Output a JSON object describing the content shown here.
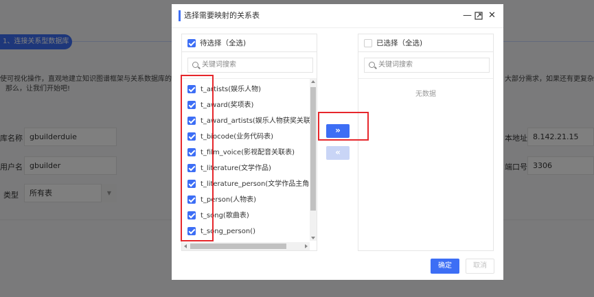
{
  "background": {
    "step_label": "1、连接关系型数据库",
    "intro_text": "使可视化操作，直观地建立知识图谱框架与关系数据库的联系；适",
    "intro_text_right": "大部分需求，如果还有更复杂的要",
    "intro_text2": "那么，让我们开始吧!",
    "fields": {
      "db_name_label": "库名称",
      "db_name_value": "gbuilderduie",
      "user_label": "用户名",
      "user_value": "gbuilder",
      "type_label": "类型",
      "type_value": "所有表",
      "host_label": "本地址",
      "host_value": "8.142.21.15",
      "port_label": "端口号",
      "port_value": "3306"
    }
  },
  "dialog": {
    "title": "选择需要映射的关系表",
    "header_icons": [
      "minimize-icon",
      "maximize-icon",
      "close-icon"
    ],
    "left_panel": {
      "header": "待选择（全选)",
      "header_checked": true,
      "search_placeholder": "关键词搜索",
      "items": [
        "t_artists(娱乐人物)",
        "t_award(奖项表)",
        "t_award_artists(娱乐人物获奖关联表)",
        "t_biocode(业务代码表)",
        "t_film_voice(影视配音关联表)",
        "t_literature(文学作品)",
        "t_literature_person(文学作品主角表)",
        "t_person(人物表)",
        "t_song(歌曲表)",
        "t_song_person()"
      ],
      "all_checked": true
    },
    "right_panel": {
      "header": "已选择（全选)",
      "header_checked": false,
      "search_placeholder": "关键词搜索",
      "empty_text": "无数据"
    },
    "transfer_right_label": "»",
    "transfer_left_label": "«",
    "ok_label": "确定",
    "cancel_label": "取消"
  },
  "colors": {
    "primary": "#3d6ef5",
    "highlight": "#e6262b"
  }
}
